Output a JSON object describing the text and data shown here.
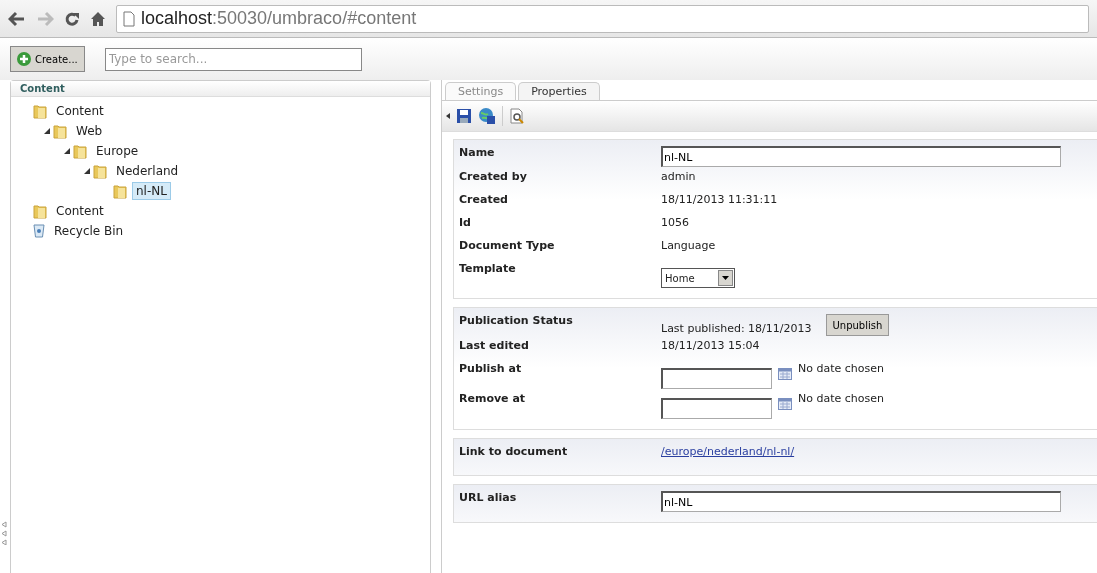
{
  "browser": {
    "url_host": "localhost",
    "url_rest": ":50030/umbraco/#content"
  },
  "toolbar": {
    "create_label": "Create...",
    "search": {
      "placeholder": "Type to search..."
    }
  },
  "tree": {
    "title": "Content",
    "items": [
      {
        "label": "Content",
        "kind": "folder",
        "selected": false,
        "children": [
          {
            "label": "Web",
            "kind": "folder",
            "selected": false,
            "expanded": true,
            "children": [
              {
                "label": "Europe",
                "kind": "folder",
                "selected": false,
                "expanded": true,
                "children": [
                  {
                    "label": "Nederland",
                    "kind": "folder",
                    "selected": false,
                    "expanded": true,
                    "children": [
                      {
                        "label": "nl-NL",
                        "kind": "folder",
                        "selected": true
                      }
                    ]
                  }
                ]
              }
            ]
          }
        ]
      },
      {
        "label": "Content",
        "kind": "folder",
        "selected": false
      },
      {
        "label": "Recycle Bin",
        "kind": "bin",
        "selected": false
      }
    ]
  },
  "tabs": [
    {
      "label": "Settings",
      "selected": false
    },
    {
      "label": "Properties",
      "selected": true
    }
  ],
  "sections": [
    {
      "rows": [
        {
          "label": "Name",
          "kind": "input",
          "value": "nl-NL"
        },
        {
          "label": "Created by",
          "kind": "text",
          "value": "admin"
        },
        {
          "label": "Created",
          "kind": "text",
          "value": "18/11/2013 11:31:11"
        },
        {
          "label": "Id",
          "kind": "text",
          "value": "1056"
        },
        {
          "label": "Document Type",
          "kind": "text",
          "value": "Language"
        },
        {
          "label": "Template",
          "kind": "select",
          "value": "Home"
        }
      ]
    },
    {
      "rows": [
        {
          "label": "Publication Status",
          "kind": "publish",
          "value": "Last published: 18/11/2013",
          "button": "Unpublish"
        },
        {
          "label": "Last edited",
          "kind": "text",
          "value": "18/11/2013 15:04"
        },
        {
          "label": "Publish at",
          "kind": "date",
          "value": "No date chosen"
        },
        {
          "label": "Remove at",
          "kind": "date",
          "value": "No date chosen"
        }
      ]
    },
    {
      "rows": [
        {
          "label": "Link to document",
          "kind": "link",
          "value": "/europe/nederland/nl-nl/"
        }
      ]
    },
    {
      "rows": [
        {
          "label": "URL alias",
          "kind": "input",
          "value": "nl-NL"
        }
      ]
    }
  ]
}
